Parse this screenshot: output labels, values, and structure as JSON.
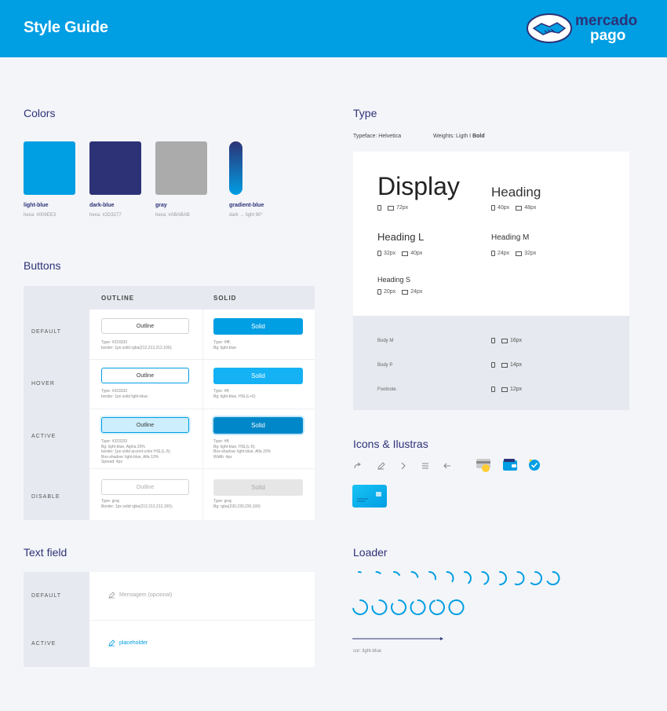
{
  "header": {
    "title": "Style Guide",
    "logo_line1": "mercado",
    "logo_line2": "pago"
  },
  "colors": {
    "title": "Colors",
    "swatches": [
      {
        "name": "light-blue",
        "hex": "hexa: #009EE3",
        "color": "#009ee3"
      },
      {
        "name": "dark-blue",
        "hex": "hexa: #2D3277",
        "color": "#2d3277"
      },
      {
        "name": "gray",
        "hex": "hexa: #ABABAB",
        "color": "#ababab"
      },
      {
        "name": "gradient-blue",
        "hex": "dark → light 90°",
        "color": "#2d3277"
      }
    ]
  },
  "buttons": {
    "title": "Buttons",
    "col_outline": "OUTLINE",
    "col_solid": "SOLID",
    "outline_label": "Outline",
    "solid_label": "Solid",
    "rows": [
      {
        "label": "DEFAULT",
        "outline_note": "Type: #333333\nborder: 1px solid rgba(212,212,212,100);",
        "solid_note": "Type: #fff;\nBg: light-blue"
      },
      {
        "label": "HOVER",
        "outline_note": "Type: #333333\nborder: 1px solid light-blue;",
        "solid_note": "Type: #ff;\nBg: light-blue, HSL(L+5)"
      },
      {
        "label": "ACTIVE",
        "outline_note": "Type: #333333\nBg: light-blue, Alpha 20%\nborder: 1px solid accent-color HSL(L-5);\nBox-shadow: light-blue, Alfa 10%\nSpread: 4px",
        "solid_note": "Type: #ff;\nBg: light-blue, HSL(L-5);\nBox-shadow: light-blue, Alfa 20%\nWidth: 4px"
      },
      {
        "label": "DISABLE",
        "outline_note": "Type: gray\nBorder: 1px solid rgba(212,212,212,100);",
        "solid_note": "Type: gray\nBg: rgba(230,230,230,100)"
      }
    ]
  },
  "textfield": {
    "title": "Text field",
    "rows": [
      {
        "label": "DEFAULT",
        "text": "Mensagem (opcional)"
      },
      {
        "label": "ACTIVE",
        "text": "placeholder"
      }
    ]
  },
  "type": {
    "title": "Type",
    "typeface": "Typeface: Helvetica",
    "weights_prefix": "Weights: Ligth I ",
    "weights_bold": "Bold",
    "samples": [
      {
        "name": "Display",
        "sizes": [
          "72px"
        ]
      },
      {
        "name": "Heading",
        "sizes": [
          "40px",
          "48px"
        ]
      },
      {
        "name": "Heading L",
        "sizes": [
          "32px",
          "40px"
        ]
      },
      {
        "name": "Heading M",
        "sizes": [
          "24px",
          "32px"
        ]
      },
      {
        "name": "Heading S",
        "sizes": [
          "20px",
          "24px"
        ]
      }
    ],
    "body": [
      {
        "name": "Body M",
        "size": "16px"
      },
      {
        "name": "Body P",
        "size": "14px"
      },
      {
        "name": "Footnote",
        "size": "12px"
      }
    ]
  },
  "icons": {
    "title": "Icons & Ilustras",
    "names": [
      "share-icon",
      "edit-icon",
      "chevron-right-icon",
      "menu-icon",
      "arrow-left-icon",
      "card-illustration",
      "wallet-illustration",
      "check-badge-illustration",
      "credit-card-illustration"
    ]
  },
  "loader": {
    "title": "Loader",
    "note": "cor: light-blue",
    "color": "#009ee3",
    "frames_row1": 12,
    "frames_row2": 6
  }
}
